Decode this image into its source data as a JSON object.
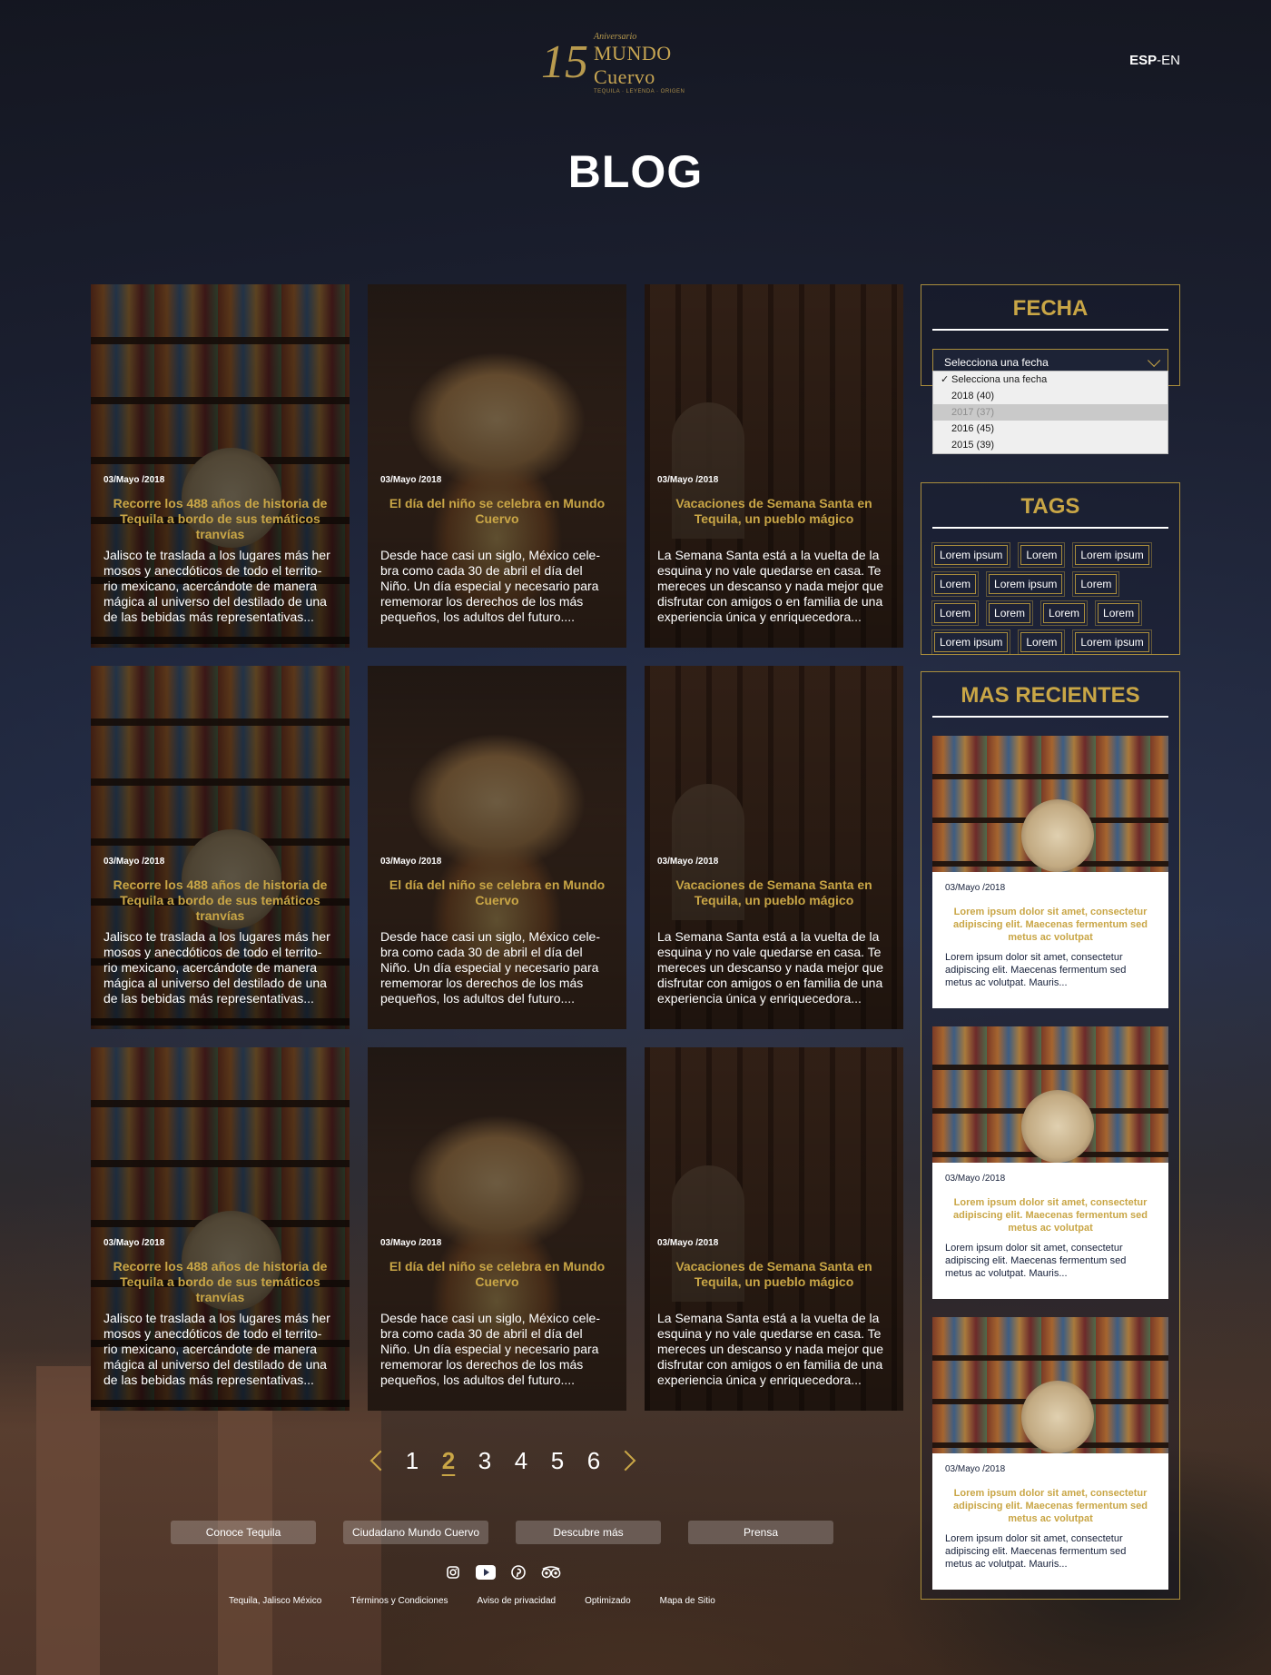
{
  "header": {
    "logo": {
      "numeral": "15",
      "tagline": "Aniversario",
      "brand": "MUNDO Cuervo",
      "sub": "TEQUILA · LEYENDA · ORIGEN"
    },
    "lang_active": "ESP",
    "lang_sep": "-",
    "lang_other": "EN"
  },
  "page_title": "BLOG",
  "cards": [
    {
      "date": "03/Mayo /2018",
      "title": "Recorre los 488 años de historia de Tequila a bordo de sus temáticos tranvías",
      "excerpt": "Jalisco te traslada a los lugares más her mosos y anecdóticos de todo el territo- rio mexicano, acercándote de manera mágica al universo del destilado de una de las bebidas más representativas..."
    },
    {
      "date": "03/Mayo /2018",
      "title": "El día del niño se celebra en Mundo Cuervo",
      "excerpt": "Desde hace casi un siglo, México cele- bra como cada 30 de abril el día del Niño. Un día especial y necesario para rememorar los derechos de los más pequeños, los adultos del futuro...."
    },
    {
      "date": "03/Mayo /2018",
      "title": "Vacaciones de Semana Santa en Tequila, un pueblo mágico",
      "excerpt": "La Semana Santa está a la vuelta de la esquina y no vale quedarse en casa. Te mereces un descanso y nada mejor que disfrutar con amigos o en familia de una experiencia única y enriquecedora..."
    },
    {
      "date": "03/Mayo /2018",
      "title": "Recorre los 488 años de historia de Tequila a bordo de sus temáticos tranvías",
      "excerpt": "Jalisco te traslada a los lugares más her mosos y anecdóticos de todo el territo- rio mexicano, acercándote de manera mágica al universo del destilado de una de las bebidas más representativas..."
    },
    {
      "date": "03/Mayo /2018",
      "title": "El día del niño se celebra en Mundo Cuervo",
      "excerpt": "Desde hace casi un siglo, México cele- bra como cada 30 de abril el día del Niño. Un día especial y necesario para rememorar los derechos de los más pequeños, los adultos del futuro...."
    },
    {
      "date": "03/Mayo /2018",
      "title": "Vacaciones de Semana Santa en Tequila, un pueblo mágico",
      "excerpt": "La Semana Santa está a la vuelta de la esquina y no vale quedarse en casa. Te mereces un descanso y nada mejor que disfrutar con amigos o en familia de una experiencia única y enriquecedora..."
    },
    {
      "date": "03/Mayo /2018",
      "title": "Recorre los 488 años de historia de Tequila a bordo de sus temáticos tranvías",
      "excerpt": "Jalisco te traslada a los lugares más her mosos y anecdóticos de todo el territo- rio mexicano, acercándote de manera mágica al universo del destilado de una de las bebidas más representativas..."
    },
    {
      "date": "03/Mayo /2018",
      "title": "El día del niño se celebra en Mundo Cuervo",
      "excerpt": "Desde hace casi un siglo, México cele- bra como cada 30 de abril el día del Niño. Un día especial y necesario para rememorar los derechos de los más pequeños, los adultos del futuro...."
    },
    {
      "date": "03/Mayo /2018",
      "title": "Vacaciones de Semana Santa en Tequila, un pueblo mágico",
      "excerpt": "La Semana Santa está a la vuelta de la esquina y no vale quedarse en casa. Te mereces un descanso y nada mejor que disfrutar con amigos o en familia de una experiencia única y enriquecedora..."
    }
  ],
  "sidebar": {
    "fecha": {
      "title": "FECHA",
      "placeholder": "Selecciona una fecha",
      "options": [
        "Selecciona una fecha",
        "2018 (40)",
        "2017 (37)",
        "2016 (45)",
        "2015 (39)"
      ],
      "selected_index": 0,
      "hover_index": 2
    },
    "tags": {
      "title": "TAGS",
      "items": [
        "Lorem ipsum",
        "Lorem",
        "Lorem ipsum",
        "Lorem",
        "Lorem ipsum",
        "Lorem",
        "Lorem",
        "Lorem",
        "Lorem",
        "Lorem",
        "Lorem ipsum",
        "Lorem",
        "Lorem ipsum"
      ]
    },
    "recent": {
      "title": "MAS RECIENTES",
      "items": [
        {
          "date": "03/Mayo /2018",
          "title": "Lorem ipsum dolor sit amet, consectetur adipiscing elit. Maecenas fermentum sed metus ac volutpat",
          "excerpt": "Lorem ipsum dolor sit amet, consectetur adipiscing elit. Maecenas fermentum sed metus ac volutpat. Mauris..."
        },
        {
          "date": "03/Mayo /2018",
          "title": "Lorem ipsum dolor sit amet, consectetur adipiscing elit. Maecenas fermentum sed metus ac volutpat",
          "excerpt": "Lorem ipsum dolor sit amet, consectetur adipiscing elit. Maecenas fermentum sed metus ac volutpat. Mauris..."
        },
        {
          "date": "03/Mayo /2018",
          "title": "Lorem ipsum dolor sit amet, consectetur adipiscing elit. Maecenas fermentum sed metus ac volutpat",
          "excerpt": "Lorem ipsum dolor sit amet, consectetur adipiscing elit. Maecenas fermentum sed metus ac volutpat. Mauris..."
        }
      ]
    }
  },
  "pagination": {
    "pages": [
      "1",
      "2",
      "3",
      "4",
      "5",
      "6"
    ],
    "current": "2"
  },
  "footer": {
    "buttons": [
      "Conoce Tequila",
      "Ciudadano Mundo Cuervo",
      "Descubre más",
      "Prensa"
    ],
    "social_icons": [
      "instagram-icon",
      "youtube-icon",
      "pinterest-icon",
      "tripadvisor-icon"
    ],
    "links": [
      "Tequila, Jalisco México",
      "Términos y Condiciones",
      "Aviso de privacidad",
      "Optimizado",
      "Mapa de Sitio"
    ]
  },
  "colors": {
    "gold": "#c9a646",
    "navy": "#16203a",
    "border_gold": "#a98d3c"
  }
}
